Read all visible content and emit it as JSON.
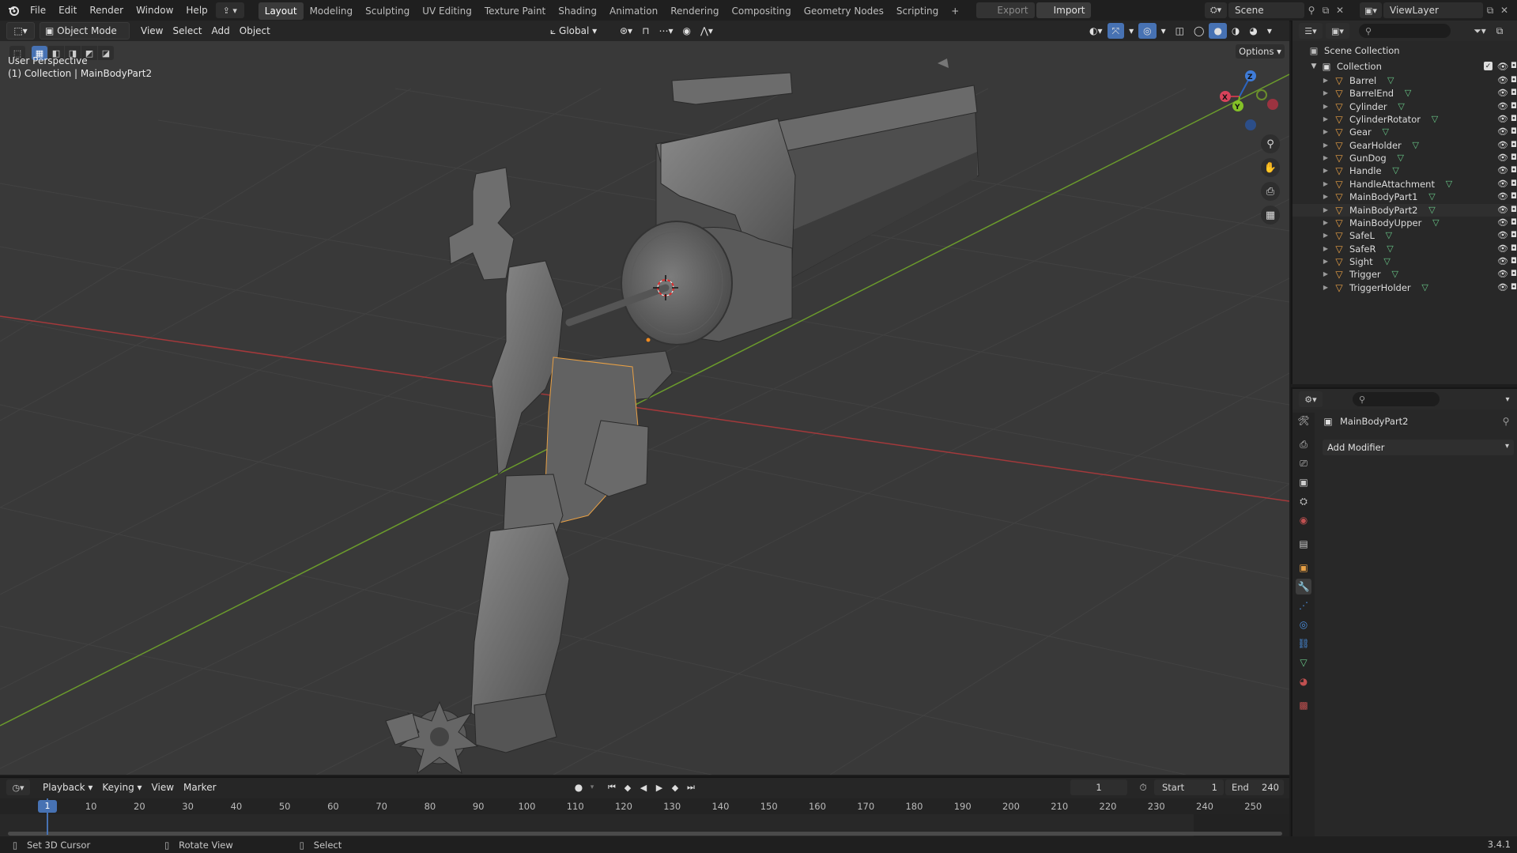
{
  "topbar": {
    "menus": [
      "File",
      "Edit",
      "Render",
      "Window",
      "Help"
    ],
    "workspaces": [
      "Layout",
      "Modeling",
      "Sculpting",
      "UV Editing",
      "Texture Paint",
      "Shading",
      "Animation",
      "Rendering",
      "Compositing",
      "Geometry Nodes",
      "Scripting"
    ],
    "active_workspace": "Layout",
    "add_tab": "+",
    "export_label": "Export",
    "import_label": "Import",
    "scene_name": "Scene",
    "view_layer_name": "ViewLayer"
  },
  "viewport_header": {
    "mode": "Object Mode",
    "menus": [
      "View",
      "Select",
      "Add",
      "Object"
    ],
    "orientation": "Global",
    "options_label": "Options"
  },
  "viewport": {
    "view_name": "User Perspective",
    "collection_info": "(1) Collection | MainBodyPart2",
    "gizmo": {
      "x": "X",
      "y": "Y",
      "z": "Z"
    }
  },
  "outliner": {
    "scene_collection": "Scene Collection",
    "collection": "Collection",
    "items": [
      "Barrel",
      "BarrelEnd",
      "Cylinder",
      "CylinderRotator",
      "Gear",
      "GearHolder",
      "GunDog",
      "Handle",
      "HandleAttachment",
      "MainBodyPart1",
      "MainBodyPart2",
      "MainBodyUpper",
      "SafeL",
      "SafeR",
      "Sight",
      "Trigger",
      "TriggerHolder"
    ],
    "selected_item": "MainBodyPart2"
  },
  "properties": {
    "object_name": "MainBodyPart2",
    "add_modifier_label": "Add Modifier"
  },
  "timeline": {
    "menus": [
      "Playback",
      "Keying",
      "View",
      "Marker"
    ],
    "current_frame": "1",
    "start_label": "Start",
    "start_value": "1",
    "end_label": "End",
    "end_value": "240",
    "ruler_labels": [
      "1",
      "10",
      "20",
      "30",
      "40",
      "50",
      "60",
      "70",
      "80",
      "90",
      "100",
      "110",
      "120",
      "130",
      "140",
      "150",
      "160",
      "170",
      "180",
      "190",
      "200",
      "210",
      "220",
      "230",
      "240",
      "250"
    ]
  },
  "statusbar": {
    "hint1": "Set 3D Cursor",
    "hint2": "Rotate View",
    "hint3": "Select",
    "version": "3.4.1"
  },
  "colors": {
    "accent": "#4772b3",
    "object_orange": "#e8a045",
    "mesh_green": "#69c788",
    "axis_red": "#a3393b",
    "axis_green": "#6b9b2c"
  }
}
